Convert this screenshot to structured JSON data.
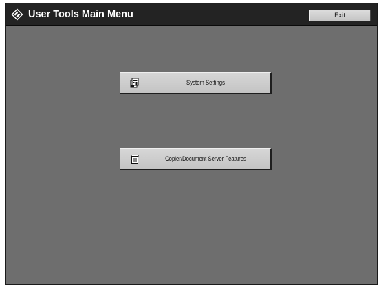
{
  "window": {
    "title": "User Tools Main Menu",
    "title_icon": "user-tools-diamond-icon"
  },
  "header": {
    "exit_label": "Exit"
  },
  "menu": {
    "items": [
      {
        "label": "System Settings",
        "icon": "system-settings-icon"
      },
      {
        "label": "Copier/Document Server Features",
        "icon": "copier-document-server-icon"
      }
    ]
  },
  "colors": {
    "background": "#6e6e6e",
    "title_bar": "#232323",
    "title_text": "#ffffff",
    "button_face": "#cccccc"
  }
}
